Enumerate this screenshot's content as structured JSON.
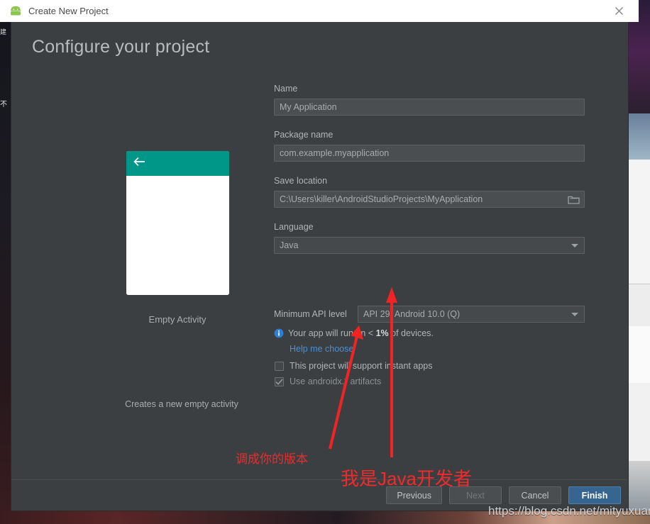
{
  "window": {
    "title": "Create New Project",
    "app_icon": "android-robot-icon",
    "close_icon": "close-icon"
  },
  "heading": "Configure your project",
  "preview": {
    "back_icon": "back-arrow-icon",
    "template_name": "Empty Activity",
    "template_description": "Creates a new empty activity",
    "appbar_color": "#009688"
  },
  "form": {
    "name": {
      "label": "Name",
      "value": "My Application"
    },
    "package": {
      "label": "Package name",
      "value": "com.example.myapplication"
    },
    "save_location": {
      "label": "Save location",
      "value": "C:\\Users\\killer\\AndroidStudioProjects\\MyApplication",
      "browse_icon": "folder-icon"
    },
    "language": {
      "label": "Language",
      "value": "Java",
      "caret_icon": "chevron-down-icon"
    },
    "min_api": {
      "label": "Minimum API level",
      "value": "API 29: Android 10.0 (Q)",
      "caret_icon": "chevron-down-icon"
    },
    "devices_info": {
      "icon": "info-icon",
      "prefix": "Your app will run on < ",
      "percent": "1%",
      "suffix": " of devices."
    },
    "help_link": "Help me choose",
    "instant_apps": {
      "label": "This project will support instant apps",
      "checked": false
    },
    "androidx": {
      "label": "Use androidx.* artifacts",
      "checked": true,
      "disabled": true
    }
  },
  "footer": {
    "previous": "Previous",
    "next": "Next",
    "cancel": "Cancel",
    "finish": "Finish"
  },
  "annotations": {
    "note_api": "调成你的版本",
    "note_language": "我是Java开发者",
    "arrow_api": "red-arrow-icon",
    "arrow_language": "red-arrow-icon"
  },
  "watermark": "https://blog.csdn.net/mityuxuan",
  "background": {
    "left_text_1": "建",
    "left_text_2": "不"
  },
  "colors": {
    "dialog_bg": "#3c3f41",
    "accent_blue": "#4a8fd4",
    "primary_button": "#36658f",
    "annotation_red": "#ef2b2b",
    "teal": "#009688"
  }
}
